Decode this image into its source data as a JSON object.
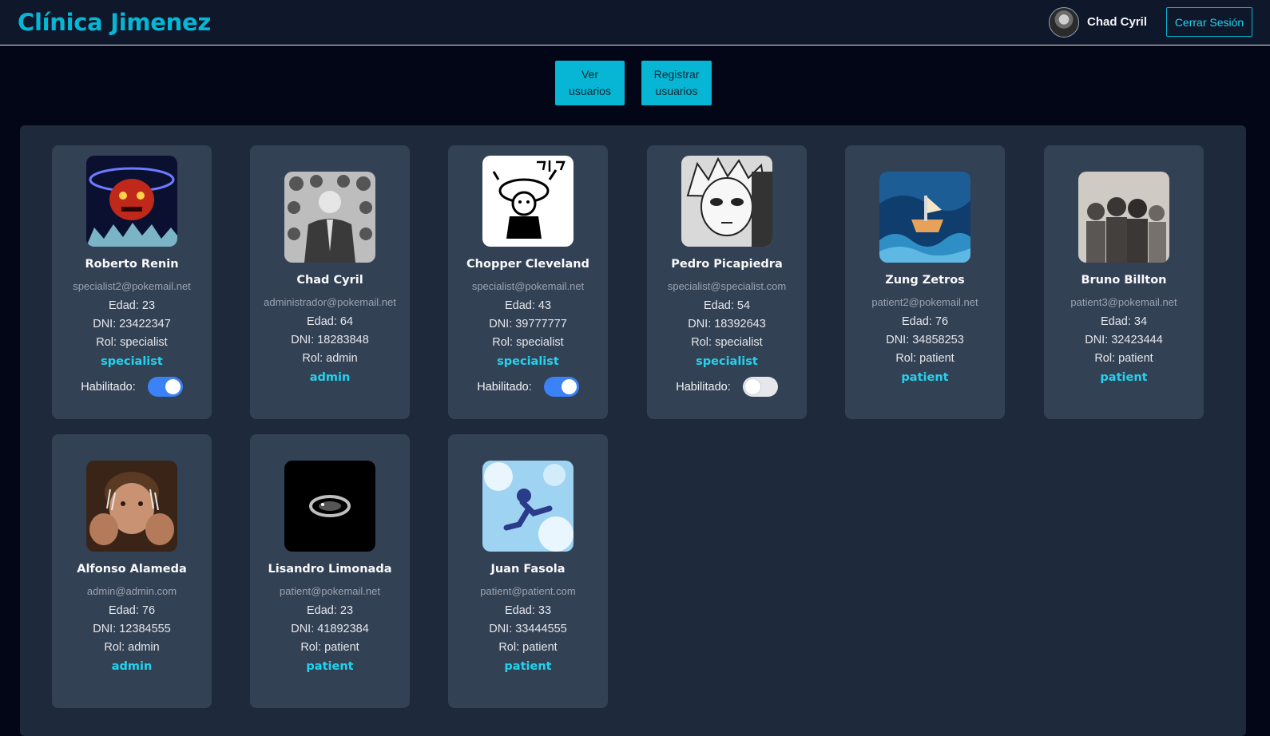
{
  "brand": "Clínica Jimenez",
  "nav": {
    "username": "Chad Cyril",
    "logout_label": "Cerrar Sesión"
  },
  "actions": {
    "view_users": "Ver usuarios",
    "register_users": "Registrar usuarios"
  },
  "toggle_label": "Habilitado:",
  "colors": {
    "accent": "#06b6d4",
    "toggle_on": "#3b82f6",
    "card_bg": "#334155",
    "panel_bg": "#1e293b"
  },
  "users": [
    {
      "name": "Roberto Renin",
      "email": "specialist2@pokemail.net",
      "age": "Edad: 23",
      "dni": "DNI: 23422347",
      "role_line": "Rol: specialist",
      "role": "specialist",
      "enabled": true,
      "avatar_icon": "demon-art-icon"
    },
    {
      "name": "Chad Cyril",
      "email": "administrador@pokemail.net",
      "age": "Edad: 64",
      "dni": "DNI: 18283848",
      "role_line": "Rol: admin",
      "role": "admin",
      "avatar_icon": "suited-man-icon"
    },
    {
      "name": "Chopper Cleveland",
      "email": "specialist@pokemail.net",
      "age": "Edad: 43",
      "dni": "DNI: 39777777",
      "role_line": "Rol: specialist",
      "role": "specialist",
      "enabled": true,
      "avatar_icon": "manga-chopper-icon"
    },
    {
      "name": "Pedro Picapiedra",
      "email": "specialist@specialist.com",
      "age": "Edad: 54",
      "dni": "DNI: 18392643",
      "role_line": "Rol: specialist",
      "role": "specialist",
      "enabled": false,
      "avatar_icon": "manga-boy-icon"
    },
    {
      "name": "Zung Zetros",
      "email": "patient2@pokemail.net",
      "age": "Edad: 76",
      "dni": "DNI: 34858253",
      "role_line": "Rol: patient",
      "role": "patient",
      "avatar_icon": "ship-waves-icon"
    },
    {
      "name": "Bruno Billton",
      "email": "patient3@pokemail.net",
      "age": "Edad: 34",
      "dni": "DNI: 32423444",
      "role_line": "Rol: patient",
      "role": "patient",
      "avatar_icon": "group-photo-icon"
    },
    {
      "name": "Alfonso Alameda",
      "email": "admin@admin.com",
      "age": "Edad: 76",
      "dni": "DNI: 12384555",
      "role_line": "Rol: admin",
      "role": "admin",
      "avatar_icon": "man-claws-icon"
    },
    {
      "name": "Lisandro Limonada",
      "email": "patient@pokemail.net",
      "age": "Edad: 23",
      "dni": "DNI: 41892384",
      "role_line": "Rol: patient",
      "role": "patient",
      "avatar_icon": "dark-ring-icon"
    },
    {
      "name": "Juan Fasola",
      "email": "patient@patient.com",
      "age": "Edad: 33",
      "dni": "DNI: 33444555",
      "role_line": "Rol: patient",
      "role": "patient",
      "avatar_icon": "sky-jump-icon"
    }
  ]
}
